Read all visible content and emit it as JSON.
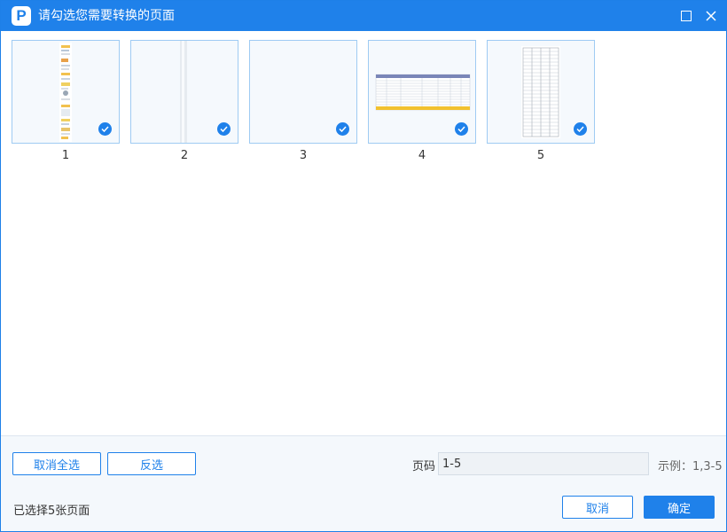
{
  "window": {
    "title": "请勾选您需要转换的页面",
    "logo_letter": "P"
  },
  "pages": [
    {
      "number": "1",
      "selected": true
    },
    {
      "number": "2",
      "selected": true
    },
    {
      "number": "3",
      "selected": true
    },
    {
      "number": "4",
      "selected": true
    },
    {
      "number": "5",
      "selected": true
    }
  ],
  "footer": {
    "deselect_all_label": "取消全选",
    "invert_label": "反选",
    "page_range_label": "页码",
    "page_range_value": "1-5",
    "example_text": "示例：1,3-5",
    "status_text": "已选择5张页面",
    "cancel_label": "取消",
    "confirm_label": "确定"
  },
  "colors": {
    "accent": "#1f81ea",
    "thumb_border": "#9fcbf3",
    "footer_bg": "#f4f8fc"
  }
}
